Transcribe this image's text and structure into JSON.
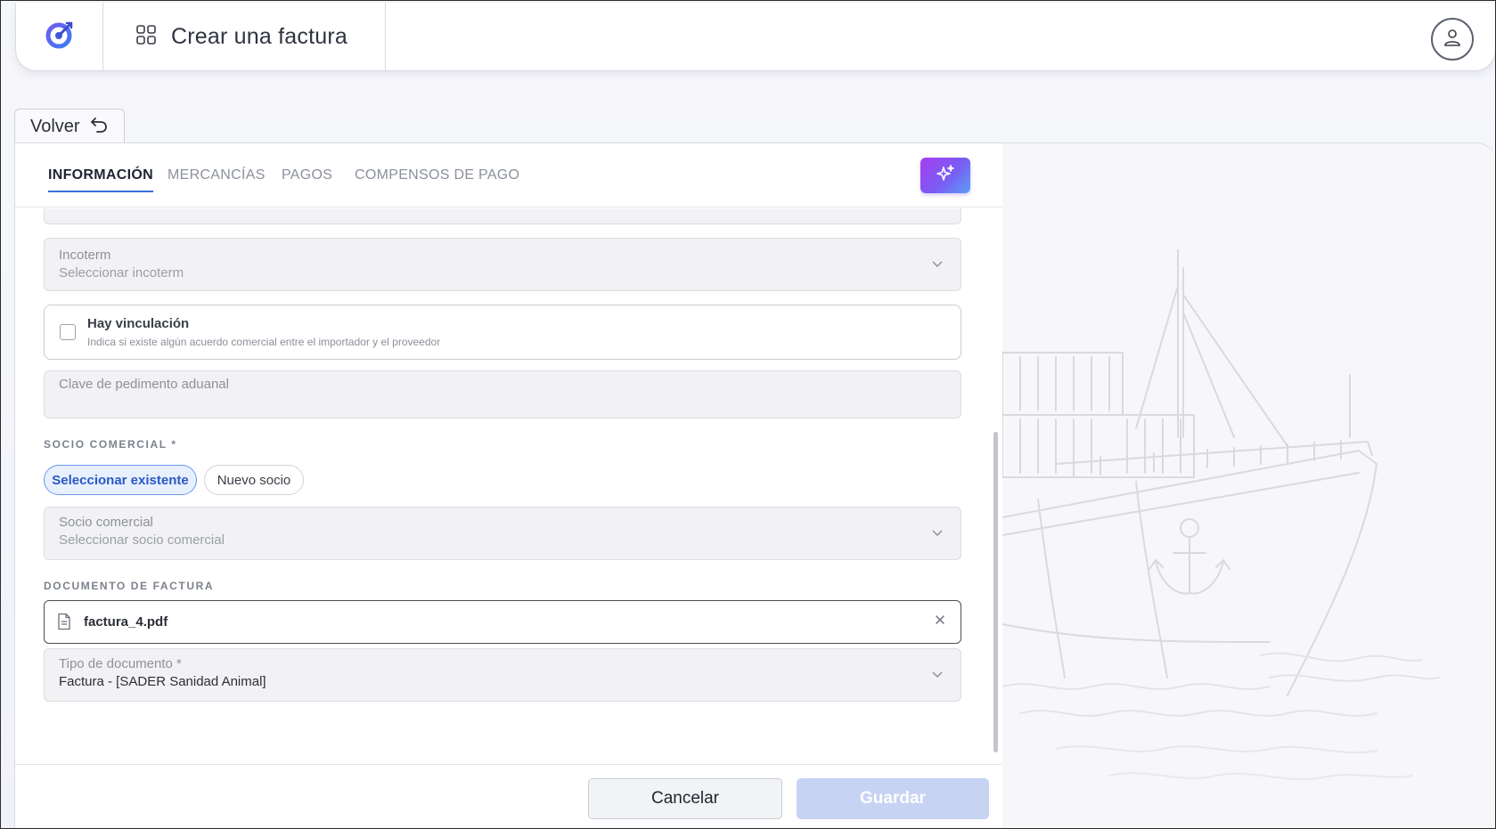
{
  "header": {
    "title": "Crear una factura",
    "logo_icon": "app-logo-icon",
    "apps_icon": "grid-icon",
    "user_icon": "user-icon"
  },
  "back": {
    "label": "Volver",
    "icon": "undo-arrow-icon"
  },
  "tabs": [
    {
      "label": "INFORMACIÓN",
      "active": true
    },
    {
      "label": "MERCANCÍAS",
      "active": false
    },
    {
      "label": "PAGOS",
      "active": false
    },
    {
      "label": "COMPENSOS DE PAGO",
      "active": false
    }
  ],
  "ai_button": {
    "icon": "sparkles-icon"
  },
  "form": {
    "incoterm": {
      "label": "Incoterm",
      "placeholder": "Seleccionar incoterm"
    },
    "vinculacion": {
      "title": "Hay vinculación",
      "description": "Indica si existe algún acuerdo comercial entre el importador y el proveedor",
      "checked": false
    },
    "clave": {
      "label": "Clave de pedimento aduanal"
    },
    "socio_section": "SOCIO COMERCIAL *",
    "socio_options": [
      "Seleccionar existente",
      "Nuevo socio"
    ],
    "socio": {
      "label": "Socio comercial",
      "placeholder": "Seleccionar socio comercial"
    },
    "documento_section": "DOCUMENTO DE FACTURA",
    "file": {
      "name": "factura_4.pdf"
    },
    "tipo": {
      "label": "Tipo de documento *",
      "value": "Factura - [SADER Sanidad Animal]"
    }
  },
  "footer": {
    "cancel": "Cancelar",
    "save": "Guardar"
  },
  "colors": {
    "accent": "#3b6fd8",
    "ai_gradient_start": "#a53ff0",
    "ai_gradient_end": "#5aa0f5",
    "save_disabled": "#c7d3f3"
  }
}
